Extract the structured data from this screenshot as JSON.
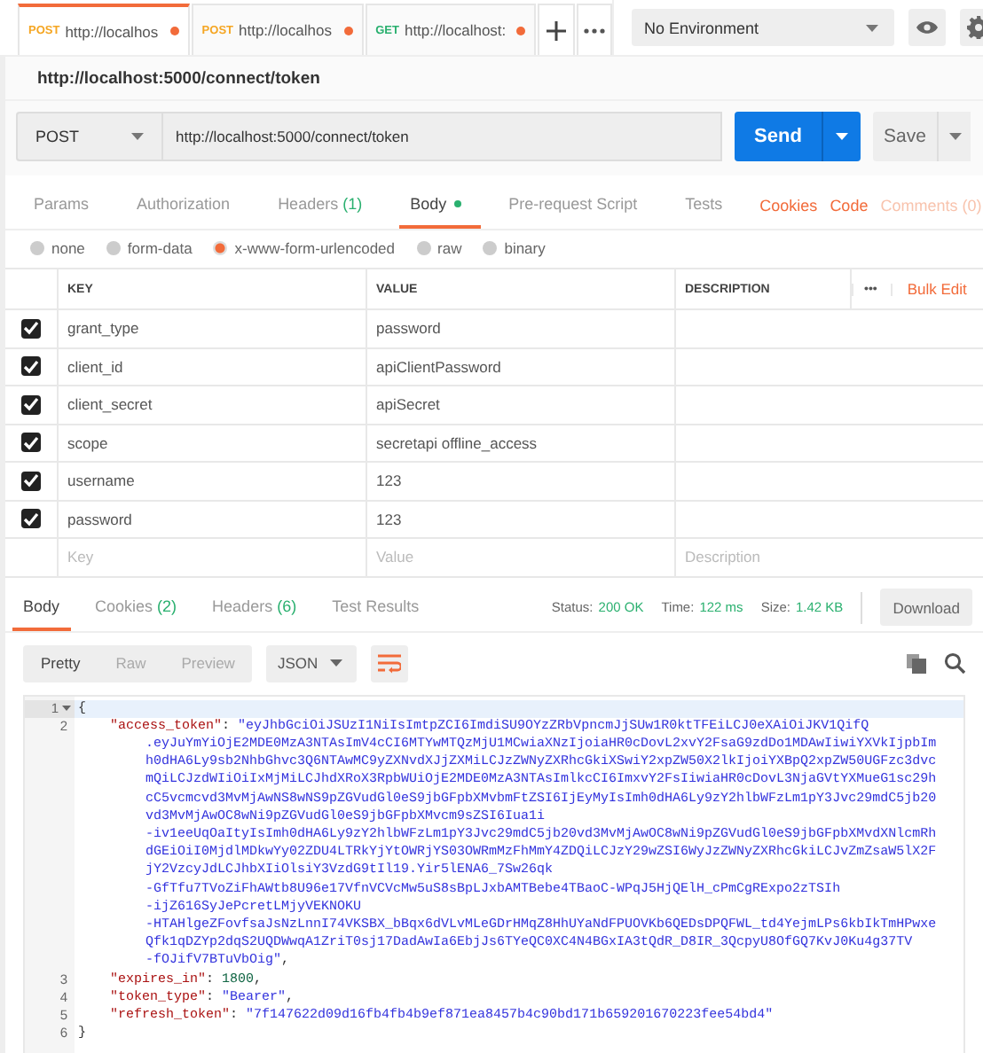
{
  "tabs": [
    {
      "method": "POST",
      "color": "#f5a623",
      "url": "http://localhos",
      "selected": true,
      "unsaved": true
    },
    {
      "method": "POST",
      "color": "#f5a623",
      "url": "http://localhos",
      "selected": false,
      "unsaved": true
    },
    {
      "method": "GET",
      "color": "#2ab06f",
      "url": "http://localhost:",
      "selected": false,
      "unsaved": true
    }
  ],
  "environment": "No Environment",
  "request_title": "http://localhost:5000/connect/token",
  "method": "POST",
  "url": "http://localhost:5000/connect/token",
  "send": "Send",
  "save": "Save",
  "request_tabs": [
    {
      "label": "Params",
      "selected": false,
      "dot": false
    },
    {
      "label": "Authorization",
      "selected": false,
      "dot": false
    },
    {
      "label": "Headers",
      "count": "(1)",
      "selected": false,
      "dot": false
    },
    {
      "label": "Body",
      "selected": true,
      "dot": true
    },
    {
      "label": "Pre-request Script",
      "selected": false,
      "dot": false
    },
    {
      "label": "Tests",
      "selected": false,
      "dot": false
    }
  ],
  "request_links": [
    {
      "label": "Cookies",
      "disabled": false
    },
    {
      "label": "Code",
      "disabled": false
    },
    {
      "label": "Comments (0)",
      "disabled": true
    }
  ],
  "body_modes": [
    {
      "label": "none",
      "selected": false
    },
    {
      "label": "form-data",
      "selected": false
    },
    {
      "label": "x-www-form-urlencoded",
      "selected": true
    },
    {
      "label": "raw",
      "selected": false
    },
    {
      "label": "binary",
      "selected": false
    }
  ],
  "params_table": {
    "columns": [
      "KEY",
      "VALUE",
      "DESCRIPTION"
    ],
    "more": "•••",
    "bulk_edit": "Bulk Edit",
    "rows": [
      {
        "key": "grant_type",
        "value": "password",
        "checked": true
      },
      {
        "key": "client_id",
        "value": "apiClientPassword",
        "checked": true
      },
      {
        "key": "client_secret",
        "value": "apiSecret",
        "checked": true
      },
      {
        "key": "scope",
        "value": "secretapi offline_access",
        "checked": true
      },
      {
        "key": "username",
        "value": "123",
        "checked": true
      },
      {
        "key": "password",
        "value": "123",
        "checked": true
      }
    ],
    "new_row": {
      "key_placeholder": "Key",
      "value_placeholder": "Value",
      "description_placeholder": "Description"
    }
  },
  "response_tabs": [
    {
      "label": "Body",
      "selected": true
    },
    {
      "label": "Cookies",
      "count": "(2)",
      "selected": false
    },
    {
      "label": "Headers",
      "count": "(6)",
      "selected": false
    },
    {
      "label": "Test Results",
      "selected": false
    }
  ],
  "response_status": [
    {
      "label": "Status:",
      "value": "200 OK"
    },
    {
      "label": "Time:",
      "value": "122 ms"
    },
    {
      "label": "Size:",
      "value": "1.42 KB"
    }
  ],
  "download": "Download",
  "view_modes": [
    {
      "label": "Pretty",
      "selected": true
    },
    {
      "label": "Raw",
      "selected": false
    },
    {
      "label": "Preview",
      "selected": false
    }
  ],
  "format": "JSON",
  "code_lines": [
    {
      "kind": "root",
      "number": "1",
      "highlighted": true,
      "segments": [
        {
          "kind": "punct",
          "text": "{"
        }
      ]
    },
    {
      "kind": "member",
      "number": "2",
      "highlighted": false,
      "segments": [
        {
          "kind": "key",
          "text": "\"access_token\""
        },
        {
          "kind": "punct",
          "text": ": "
        },
        {
          "kind": "string",
          "text": "\"eyJhbGciOiJSUzI1NiIsImtpZCI6ImdiSU9OYzZRbVpncmJjSUw1R0ktTFEiLCJ0eXAiOiJKV1QifQ"
        }
      ]
    },
    {
      "kind": "wrap",
      "segments": [
        {
          "kind": "string",
          "text": ".eyJuYmYiOjE2MDE0MzA3NTAsImV4cCI6MTYwMTQzMjU1MCwiaXNzIjoiaHR0cDovL2xvY2FsaG9zdDo1MDAwIiwiYXVkIjpbIm"
        }
      ]
    },
    {
      "kind": "wrap",
      "segments": [
        {
          "kind": "string",
          "text": "h0dHA6Ly9sb2NhbGhvc3Q6NTAwMC9yZXNvdXJjZXMiLCJzZWNyZXRhcGkiXSwiY2xpZW50X2lkIjoiYXBpQ2xpZW50UGFzc3dvc"
        }
      ]
    },
    {
      "kind": "wrap",
      "segments": [
        {
          "kind": "string",
          "text": "mQiLCJzdWIiOiIxMjMiLCJhdXRoX3RpbWUiOjE2MDE0MzA3NTAsImlkcCI6ImxvY2FsIiwiaHR0cDovL3NjaGVtYXMueG1sc29h"
        }
      ]
    },
    {
      "kind": "wrap",
      "segments": [
        {
          "kind": "string",
          "text": "cC5vcmcvd3MvMjAwNS8wNS9pZGVudGl0eS9jbGFpbXMvbmFtZSI6IjEyMyIsImh0dHA6Ly9zY2hlbWFzLm1pY3Jvc29mdC5jb20"
        }
      ]
    },
    {
      "kind": "wrap",
      "segments": [
        {
          "kind": "string",
          "text": "vd3MvMjAwOC8wNi9pZGVudGl0eS9jbGFpbXMvcm9sZSI6Iua1i"
        }
      ]
    },
    {
      "kind": "wrap",
      "segments": [
        {
          "kind": "string",
          "text": "-iv1eeUqOaItyIsImh0dHA6Ly9zY2hlbWFzLm1pY3Jvc29mdC5jb20vd3MvMjAwOC8wNi9pZGVudGl0eS9jbGFpbXMvdXNlcmRh"
        }
      ]
    },
    {
      "kind": "wrap",
      "segments": [
        {
          "kind": "string",
          "text": "dGEiOiI0MjdlMDkwYy02ZDU4LTRkYjYtOWRjYS03OWRmMzFhMmY4ZDQiLCJzY29wZSI6WyJzZWNyZXRhcGkiLCJvZmZsaW5lX2F"
        }
      ]
    },
    {
      "kind": "wrap",
      "segments": [
        {
          "kind": "string",
          "text": "jY2VzcyJdLCJhbXIiOlsiY3VzdG9tIl19.Yir5lENA6_7Sw26qk"
        }
      ]
    },
    {
      "kind": "wrap",
      "segments": [
        {
          "kind": "string",
          "text": "-GfTfu7TVoZiFhAWtb8U96e17VfnVCVcMw5uS8sBpLJxbAMTBebe4TBaoC-WPqJ5HjQElH_cPmCgRExpo2zTSIh"
        }
      ]
    },
    {
      "kind": "wrap",
      "segments": [
        {
          "kind": "string",
          "text": "-ijZ616SyJePcretLMjyVEKNOKU"
        }
      ]
    },
    {
      "kind": "wrap",
      "segments": [
        {
          "kind": "string",
          "text": "-HTAHlgeZFovfsaJsNzLnnI74VKSBX_bBqx6dVLvMLeGDrHMqZ8HhUYaNdFPUOVKb6QEDsDPQFWL_td4YejmLPs6kbIkTmHPwxe"
        }
      ]
    },
    {
      "kind": "wrap",
      "segments": [
        {
          "kind": "string",
          "text": "Qfk1qDZYp2dqS2UQDWwqA1ZriT0sj17DadAwIa6EbjJs6TYeQC0XC4N4BGxIA3tQdR_D8IR_3QcpyU8OfGQ7KvJ0Ku4g37TV"
        }
      ]
    },
    {
      "kind": "wrap",
      "segments": [
        {
          "kind": "string",
          "text": "-fOJifV7BTuVbOig\""
        },
        {
          "kind": "punct",
          "text": ","
        }
      ]
    },
    {
      "kind": "member",
      "number": "3",
      "highlighted": false,
      "segments": [
        {
          "kind": "key",
          "text": "\"expires_in\""
        },
        {
          "kind": "punct",
          "text": ": "
        },
        {
          "kind": "number",
          "text": "1800"
        },
        {
          "kind": "punct",
          "text": ","
        }
      ]
    },
    {
      "kind": "member",
      "number": "4",
      "highlighted": false,
      "segments": [
        {
          "kind": "key",
          "text": "\"token_type\""
        },
        {
          "kind": "punct",
          "text": ": "
        },
        {
          "kind": "string",
          "text": "\"Bearer\""
        },
        {
          "kind": "punct",
          "text": ","
        }
      ]
    },
    {
      "kind": "member",
      "number": "5",
      "highlighted": false,
      "segments": [
        {
          "kind": "key",
          "text": "\"refresh_token\""
        },
        {
          "kind": "punct",
          "text": ": "
        },
        {
          "kind": "string",
          "text": "\"7f147622d09d16fb4fb4b9ef871ea8457b4c90bd171b659201670223fee54bd4\""
        }
      ]
    },
    {
      "kind": "root",
      "number": "6",
      "highlighted": false,
      "segments": [
        {
          "kind": "punct",
          "text": "}"
        }
      ]
    }
  ]
}
